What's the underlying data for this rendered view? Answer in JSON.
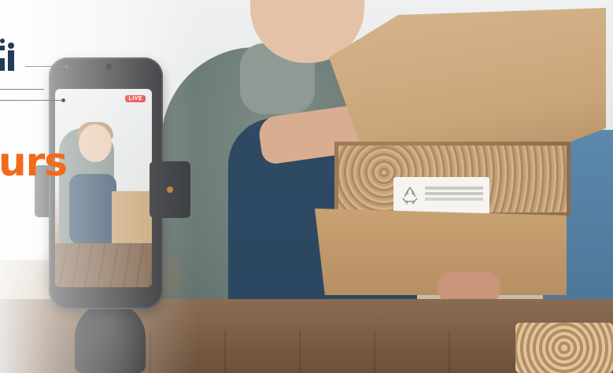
{
  "banner": {
    "brand_text": "urs",
    "live_badge": "LIVE",
    "box_label_icon": "recycle-icon",
    "logo_icon": "brand-logo-icon",
    "accent_color": "#f26a1b",
    "live_color": "#e53935"
  }
}
